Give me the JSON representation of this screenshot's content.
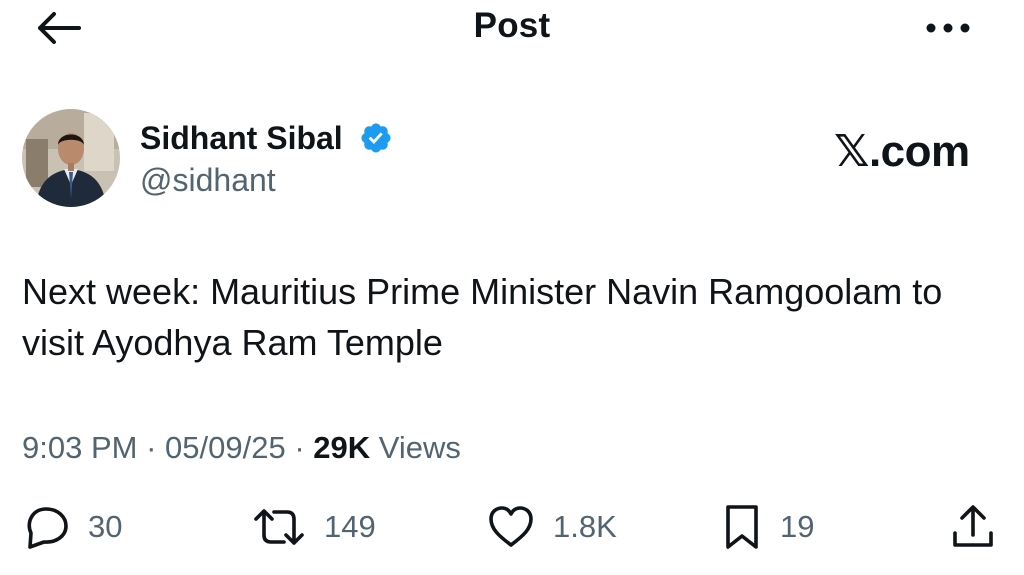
{
  "header": {
    "title": "Post"
  },
  "author": {
    "name": "Sidhant Sibal",
    "handle": "@sidhant",
    "verified": true
  },
  "brand": "𝕏.com",
  "tweet": {
    "text": "Next week: Mauritius Prime Minister Navin Ramgoolam to visit Ayodhya Ram Temple"
  },
  "meta": {
    "time": "9:03 PM",
    "date": "05/09/25",
    "views_count": "29K",
    "views_label": "Views"
  },
  "actions": {
    "replies": "30",
    "reposts": "149",
    "likes": "1.8K",
    "bookmarks": "19"
  },
  "colors": {
    "text": "#0f1419",
    "secondary": "#536471",
    "verified": "#1d9bf0"
  },
  "icons": {
    "back": "arrow-left-icon",
    "more": "more-dots-icon",
    "verified": "verified-badge-icon",
    "reply": "reply-icon",
    "repost": "repost-icon",
    "like": "heart-icon",
    "bookmark": "bookmark-icon",
    "share": "share-icon"
  }
}
